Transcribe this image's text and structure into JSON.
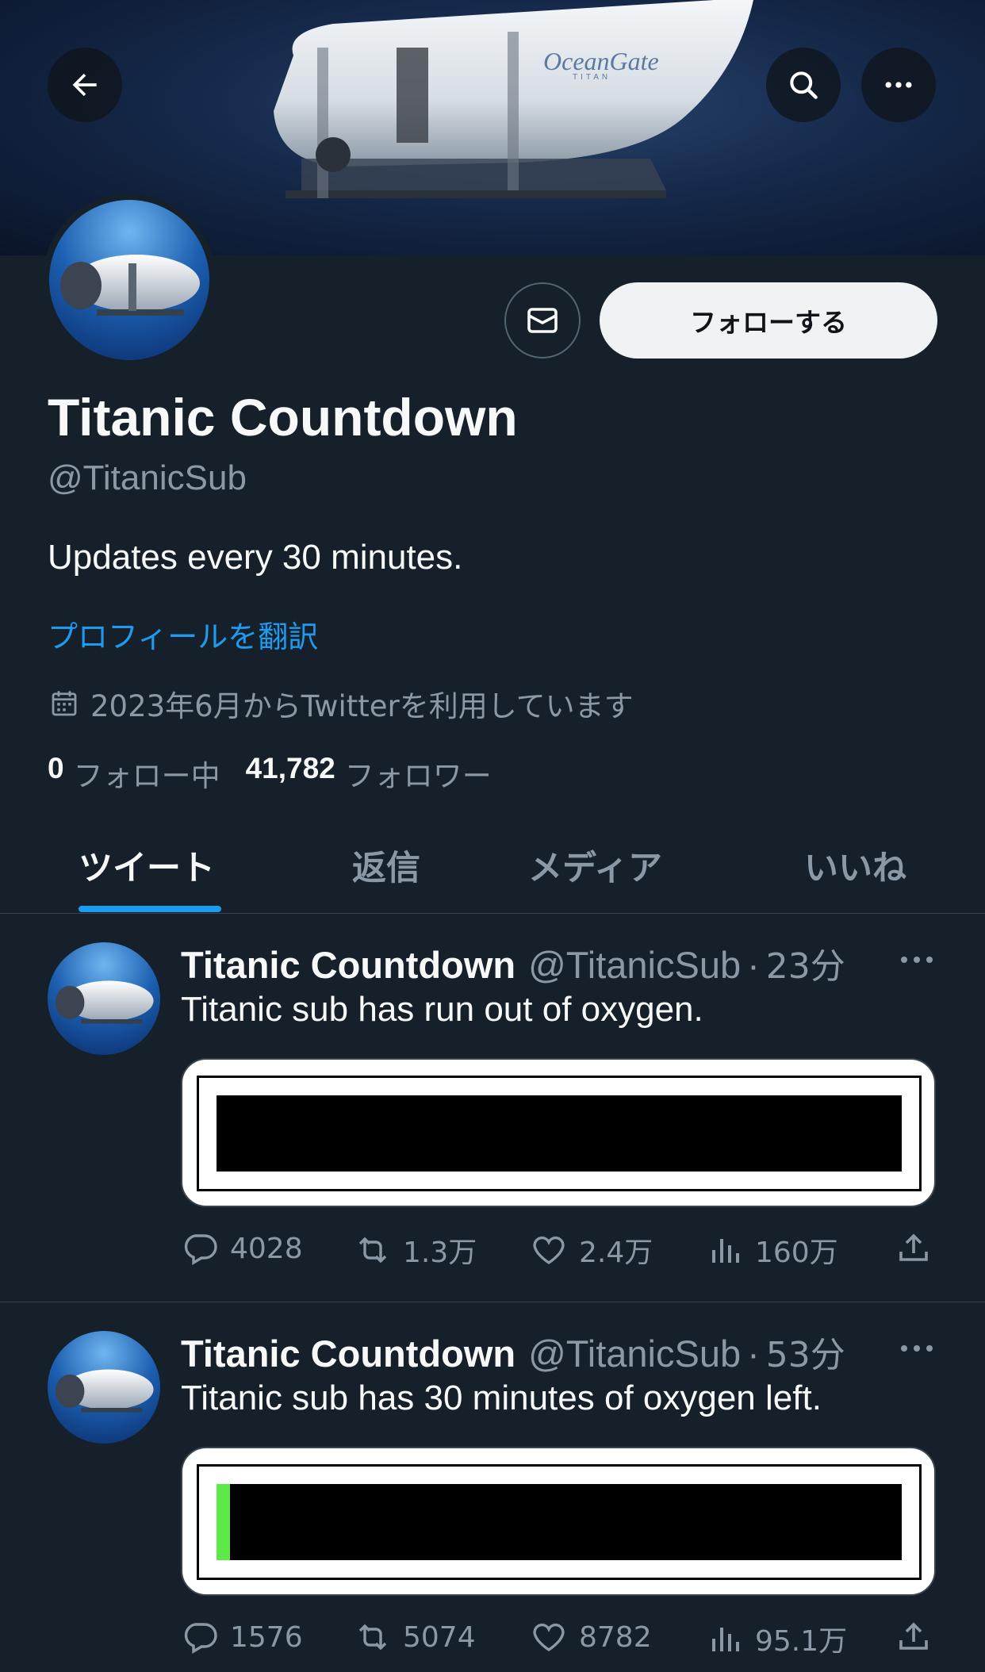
{
  "header": {
    "back_icon": "arrow-left-icon",
    "search_icon": "search-icon",
    "more_icon": "more-horizontal-icon",
    "banner_brand": "OceanGate",
    "banner_sub": "TITAN"
  },
  "profile": {
    "name": "Titanic Countdown",
    "handle": "@TitanicSub",
    "bio": "Updates every 30 minutes.",
    "translate_label": "プロフィールを翻訳",
    "joined": "2023年6月からTwitterを利用しています",
    "following_count": "0",
    "following_label": "フォロー中",
    "followers_count": "41,782",
    "followers_label": "フォロワー",
    "follow_button": "フォローする",
    "message_icon": "mail-icon"
  },
  "tabs": [
    {
      "label": "ツイート",
      "active": true
    },
    {
      "label": "返信",
      "active": false
    },
    {
      "label": "メディア",
      "active": false
    },
    {
      "label": "いいね",
      "active": false
    }
  ],
  "tweets": [
    {
      "name": "Titanic Countdown",
      "handle": "@TitanicSub",
      "separator": "·",
      "time": "23分",
      "text": "Titanic sub has run out of oxygen.",
      "oxygen_level": 0,
      "replies": "4028",
      "retweets": "1.3万",
      "likes": "2.4万",
      "views": "160万"
    },
    {
      "name": "Titanic Countdown",
      "handle": "@TitanicSub",
      "separator": "·",
      "time": "53分",
      "text": "Titanic sub has 30 minutes of oxygen left.",
      "oxygen_level": 0.02,
      "replies": "1576",
      "retweets": "5074",
      "likes": "8782",
      "views": "95.1万"
    }
  ],
  "colors": {
    "background": "#15202b",
    "accent": "#1d9bf0",
    "oxygen_fill": "#5fe84a"
  }
}
